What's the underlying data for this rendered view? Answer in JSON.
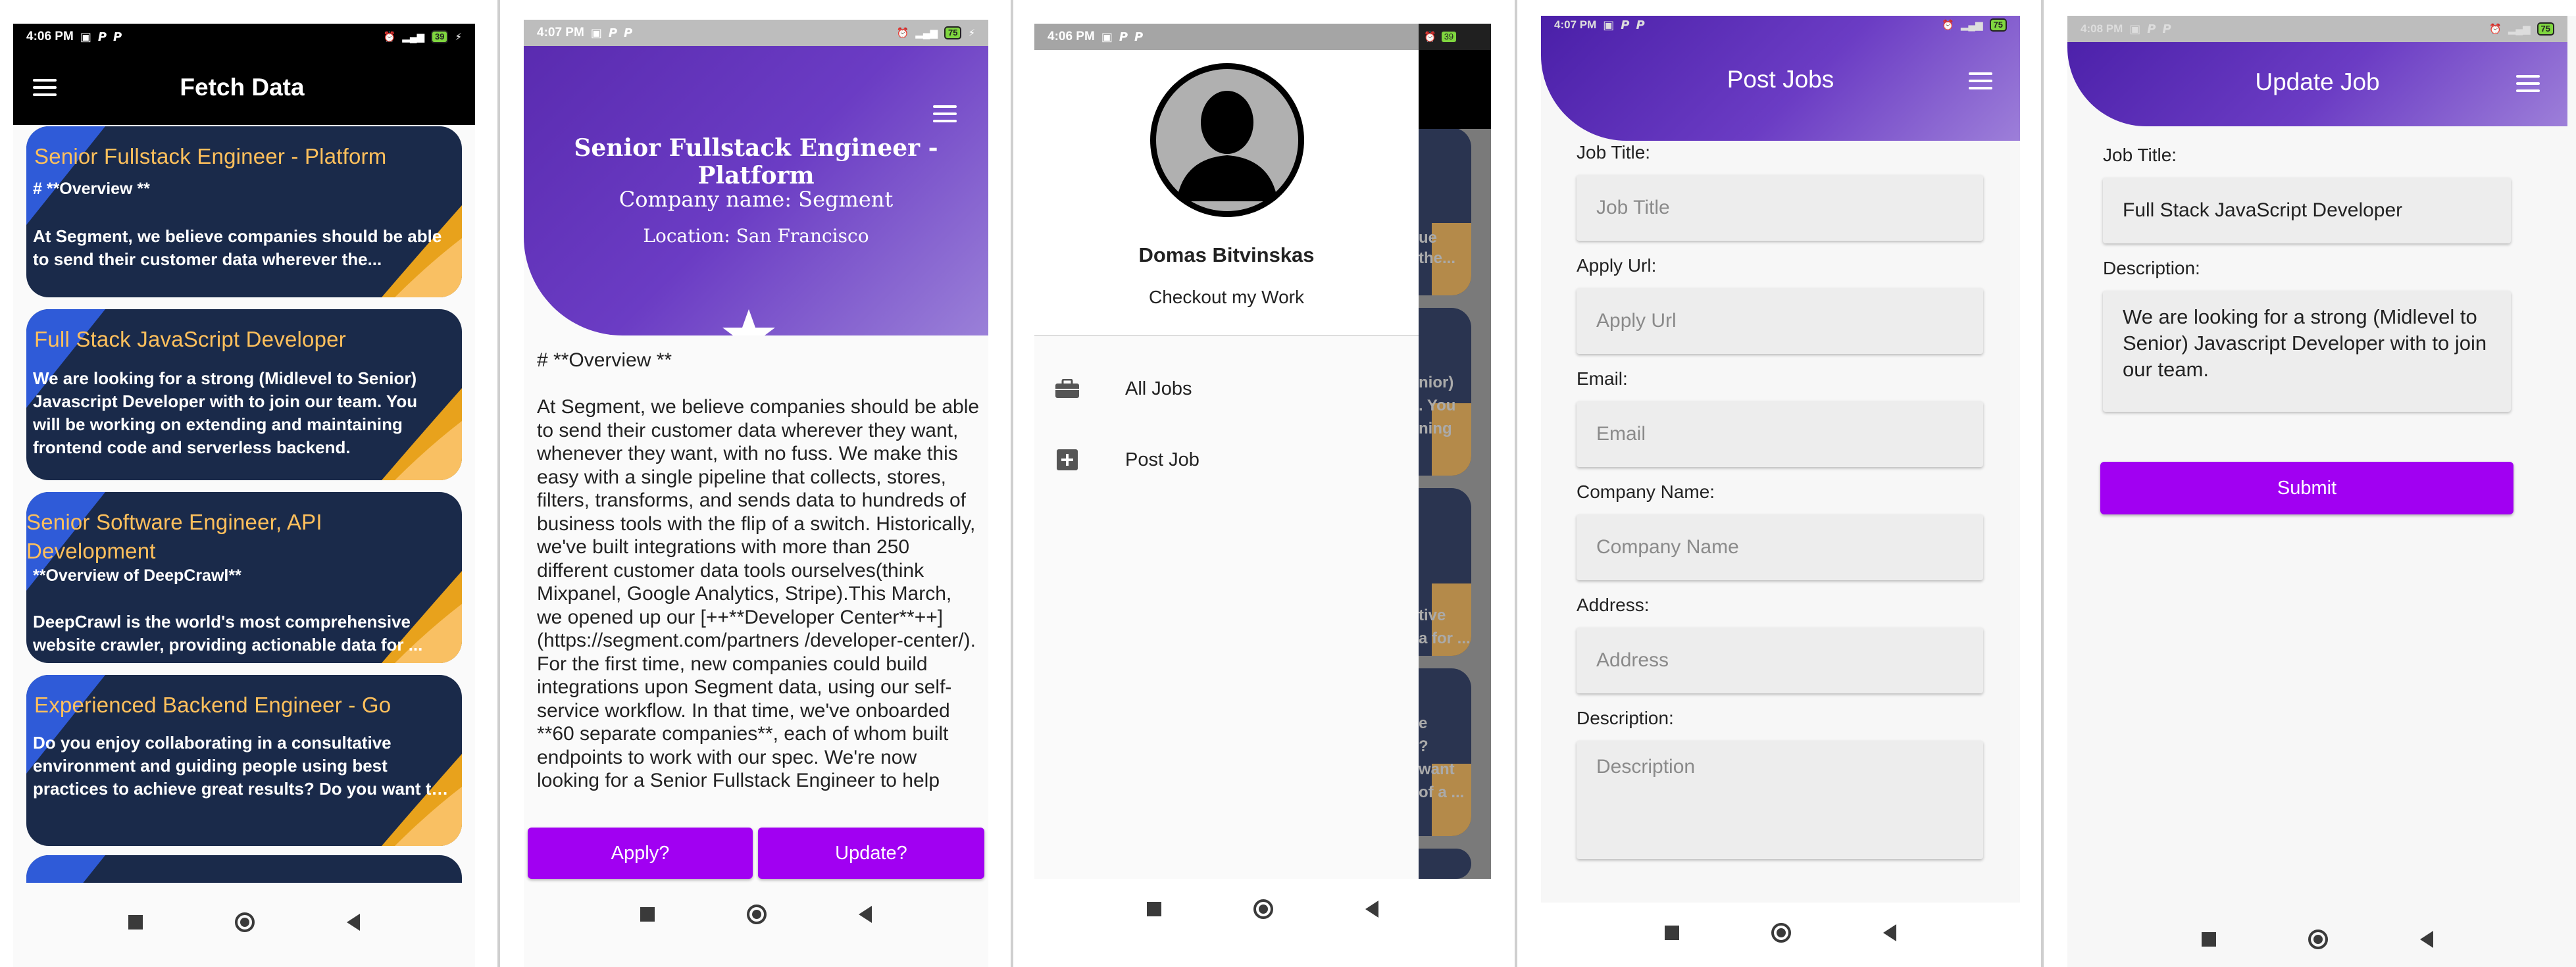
{
  "colors": {
    "accent_purple": "#a100f2",
    "card_navy": "#1a2a4a",
    "card_yellow": "#f9b84b",
    "card_blue": "#2f5bd8",
    "header_purple": "#6b3cc4",
    "title_orange": "#ffc05c"
  },
  "phone1": {
    "status": {
      "time": "4:06 PM",
      "battery": "39"
    },
    "appbar_title": "Fetch Data",
    "menu_icon": "hamburger-menu-icon",
    "cards": [
      {
        "title": "Senior Fullstack Engineer - Platform",
        "sub": "# **Overview **",
        "body": "At Segment, we believe companies should be able to send their customer data wherever the..."
      },
      {
        "title": "Full Stack JavaScript Developer",
        "sub": "",
        "body": "We are looking for a strong (Midlevel to Senior) Javascript Developer with to join our team. You will be working on extending and maintaining frontend code and serverless backend."
      },
      {
        "title": "Senior Software Engineer, API Development",
        "sub": "**Overview of DeepCrawl**",
        "body": "DeepCrawl is the world's most comprehensive website crawler, providing actionable data for ..."
      },
      {
        "title": "Experienced Backend Engineer - Go",
        "sub": "",
        "body": "Do you enjoy collaborating in a consultative environment and guiding people using best practices to achieve great results? Do you want to influence and contribute to the growth of a ..."
      }
    ]
  },
  "phone2": {
    "status": {
      "time": "4:07 PM",
      "battery": "75"
    },
    "job_title": "Senior Fullstack Engineer - Platform",
    "company": "Company name: Segment",
    "location": "Location: San Francisco",
    "description": "# **Overview **\n\nAt Segment, we believe companies should be able to send their customer data wherever they want, whenever they want, with no fuss. We make this easy with a single pipeline that collects, stores, filters, transforms, and sends data to hundreds of business tools with the flip of a switch. Historically, we've built integrations with more than 250 different customer data tools ourselves(think Mixpanel, Google Analytics, Stripe).This March, we opened up our [++**Developer Center**++](https://segment.com/partners /developer-center/). For the first time, new companies could build integrations upon Segment data, using our self-service workflow. In that time, we've onboarded **60 separate companies**, each of whom built endpoints to work with our spec. We're now looking for a Senior Fullstack Engineer to help",
    "apply_label": "Apply?",
    "update_label": "Update?"
  },
  "phone3": {
    "status": {
      "time": "4:06 PM",
      "battery": "39"
    },
    "user_name": "Domas Bitvinskas",
    "user_link": "Checkout my Work",
    "menu": [
      {
        "label": "All Jobs",
        "icon": "briefcase-icon"
      },
      {
        "label": "Post Job",
        "icon": "add-box-icon"
      }
    ],
    "peek_text": [
      "ue",
      "the...",
      "nior)",
      ". You",
      "ning",
      "tive",
      "a for ...",
      "e",
      "?",
      "want",
      "of a ..."
    ]
  },
  "phone4": {
    "status": {
      "time": "4:07 PM",
      "battery": "75"
    },
    "title": "Post Jobs",
    "fields": [
      {
        "label": "Job Title:",
        "placeholder": "Job Title"
      },
      {
        "label": "Apply Url:",
        "placeholder": "Apply Url"
      },
      {
        "label": "Email:",
        "placeholder": "Email"
      },
      {
        "label": "Company Name:",
        "placeholder": "Company Name"
      },
      {
        "label": "Address:",
        "placeholder": "Address"
      },
      {
        "label": "Description:",
        "placeholder": "Description"
      }
    ]
  },
  "phone5": {
    "status": {
      "time": "4:08 PM",
      "battery": "75"
    },
    "title": "Update Job",
    "job_title_label": "Job Title:",
    "job_title_value": "Full Stack JavaScript Developer",
    "description_label": "Description:",
    "description_value": "We are looking for a strong (Midlevel to Senior) Javascript Developer with to join our team.",
    "submit_label": "Submit"
  }
}
